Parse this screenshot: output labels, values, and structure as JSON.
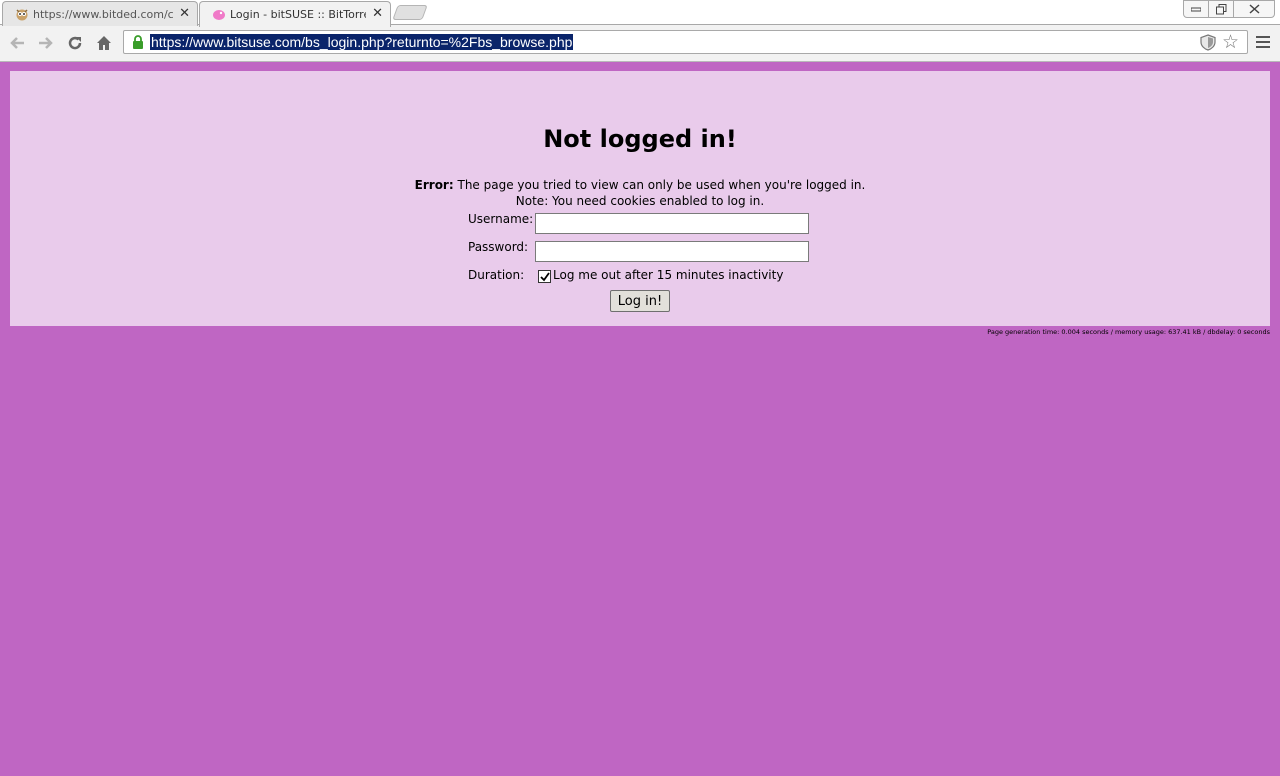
{
  "browser": {
    "tabs": [
      {
        "title": "https://www.bitded.com/cha",
        "active": false,
        "favicon": "owl-favicon-icon"
      },
      {
        "title": "Login - bitSUSE :: BitTorrent",
        "active": true,
        "favicon": "pink-lizard-favicon-icon"
      }
    ],
    "url": "https://www.bitsuse.com/bs_login.php?returnto=%2Fbs_browse.php",
    "close_glyph": "✕",
    "icons": {
      "back": "back-arrow-icon",
      "forward": "forward-arrow-icon",
      "reload": "reload-icon",
      "home": "home-icon",
      "lock": "lock-icon",
      "shield": "shield-icon",
      "star": "star-icon",
      "menu": "hamburger-menu-icon"
    }
  },
  "page": {
    "title": "Not logged in!",
    "error_prefix": "Error:",
    "error_text": "The page you tried to view can only be used when you're logged in.",
    "note": "Note: You need cookies enabled to log in.",
    "form": {
      "username_label": "Username:",
      "username_value": "",
      "password_label": "Password:",
      "password_value": "",
      "duration_label": "Duration:",
      "duration_checked": true,
      "duration_text": "Log me out after 15 minutes inactivity",
      "submit_label": "Log in!"
    },
    "footer_stats": "Page generation time: 0.004 seconds / memory usage: 637.41 kB / dbdelay: 0 seconds"
  },
  "colors": {
    "background": "#bf66c3",
    "panel": "#e9cbeb",
    "url_highlight": "#0a246a"
  }
}
